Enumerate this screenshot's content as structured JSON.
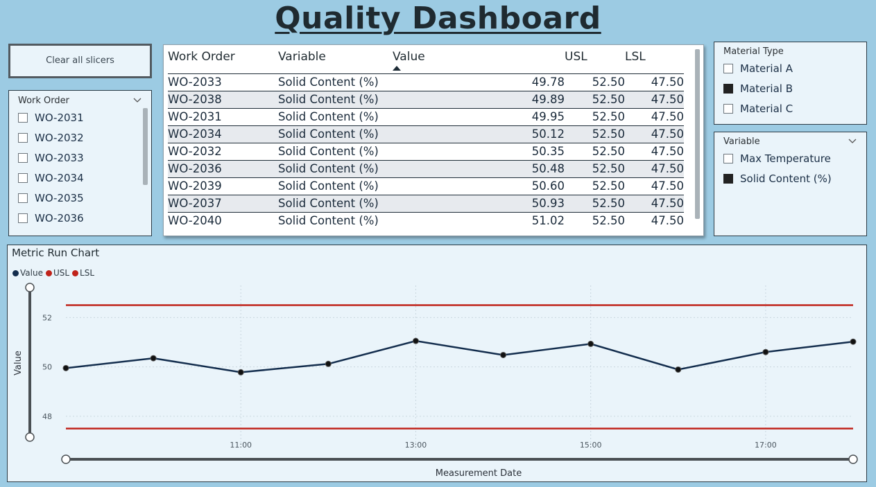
{
  "title": "Quality Dashboard",
  "clear_button": "Clear all slicers",
  "work_order_slicer": {
    "label": "Work Order",
    "items": [
      {
        "label": "WO-2031",
        "checked": false
      },
      {
        "label": "WO-2032",
        "checked": false
      },
      {
        "label": "WO-2033",
        "checked": false
      },
      {
        "label": "WO-2034",
        "checked": false
      },
      {
        "label": "WO-2035",
        "checked": false
      },
      {
        "label": "WO-2036",
        "checked": false
      }
    ]
  },
  "material_slicer": {
    "label": "Material Type",
    "items": [
      {
        "label": "Material A",
        "checked": false
      },
      {
        "label": "Material B",
        "checked": true
      },
      {
        "label": "Material C",
        "checked": false
      }
    ]
  },
  "variable_slicer": {
    "label": "Variable",
    "items": [
      {
        "label": "Max Temperature",
        "checked": false
      },
      {
        "label": "Solid Content (%)",
        "checked": true
      }
    ]
  },
  "table": {
    "headers": [
      "Work Order",
      "Variable",
      "Value",
      "USL",
      "LSL"
    ],
    "sort_column": "Value",
    "rows": [
      [
        "WO-2033",
        "Solid Content (%)",
        "49.78",
        "52.50",
        "47.50"
      ],
      [
        "WO-2038",
        "Solid Content (%)",
        "49.89",
        "52.50",
        "47.50"
      ],
      [
        "WO-2031",
        "Solid Content (%)",
        "49.95",
        "52.50",
        "47.50"
      ],
      [
        "WO-2034",
        "Solid Content (%)",
        "50.12",
        "52.50",
        "47.50"
      ],
      [
        "WO-2032",
        "Solid Content (%)",
        "50.35",
        "52.50",
        "47.50"
      ],
      [
        "WO-2036",
        "Solid Content (%)",
        "50.48",
        "52.50",
        "47.50"
      ],
      [
        "WO-2039",
        "Solid Content (%)",
        "50.60",
        "52.50",
        "47.50"
      ],
      [
        "WO-2037",
        "Solid Content (%)",
        "50.93",
        "52.50",
        "47.50"
      ],
      [
        "WO-2040",
        "Solid Content (%)",
        "51.02",
        "52.50",
        "47.50"
      ]
    ]
  },
  "chart_data": {
    "type": "line",
    "title": "Metric Run Chart",
    "xlabel": "Measurement Date",
    "ylabel": "Value",
    "x_tick_labels": [
      "11:00",
      "13:00",
      "15:00",
      "17:00"
    ],
    "x_tick_hours": [
      11,
      13,
      15,
      17
    ],
    "y_ticks": [
      48,
      50,
      52
    ],
    "ylim": [
      46.9,
      53.3
    ],
    "xlim": [
      9.0,
      18.0
    ],
    "grid": true,
    "legend_position": "top-left",
    "series": [
      {
        "name": "Value",
        "color": "#132d4d",
        "x": [
          9.0,
          10.0,
          11.0,
          12.0,
          13.0,
          14.0,
          15.0,
          16.0,
          17.0,
          18.0
        ],
        "values": [
          49.95,
          50.35,
          49.78,
          50.12,
          51.05,
          50.48,
          50.93,
          49.89,
          50.6,
          51.02
        ]
      },
      {
        "name": "USL",
        "color": "#c0231a",
        "x": [
          9.0,
          18.0
        ],
        "values": [
          52.5,
          52.5
        ]
      },
      {
        "name": "LSL",
        "color": "#c0231a",
        "x": [
          9.0,
          18.0
        ],
        "values": [
          47.5,
          47.5
        ]
      }
    ]
  }
}
